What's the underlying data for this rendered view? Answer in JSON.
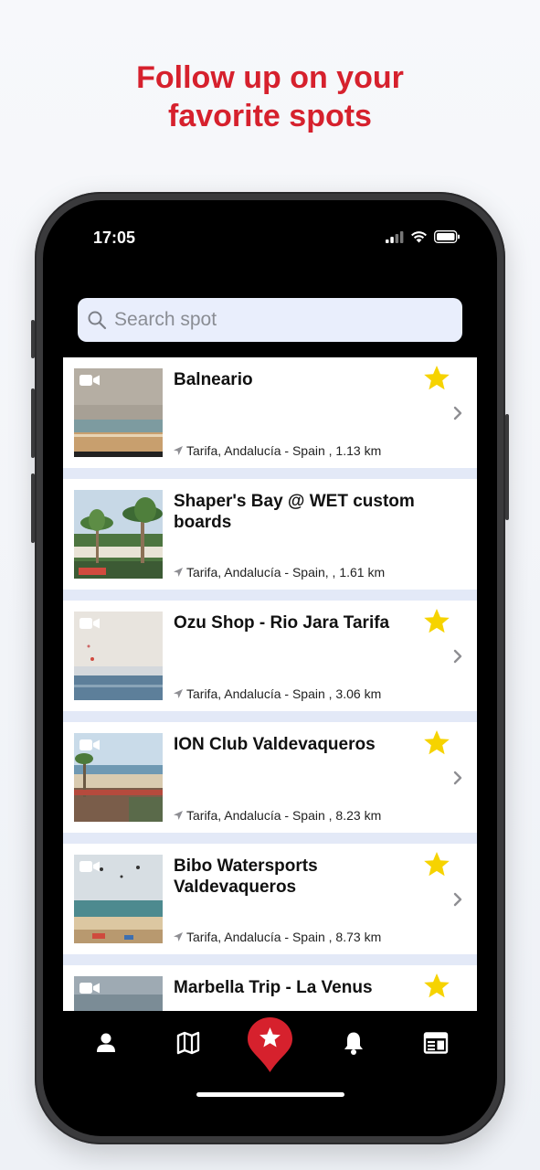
{
  "headline": {
    "line1": "Follow up on your",
    "line2": "favorite spots"
  },
  "status_bar": {
    "time": "17:05"
  },
  "search": {
    "placeholder": "Search spot"
  },
  "spots": [
    {
      "title": "Balneario",
      "location": "Tarifa, Andalucía - Spain , 1.13 km",
      "favorite": true,
      "has_camera": true
    },
    {
      "title": "Shaper's Bay @ WET custom boards",
      "location": "Tarifa, Andalucía - Spain, , 1.61 km",
      "favorite": false,
      "has_camera": false
    },
    {
      "title": "Ozu Shop - Rio Jara Tarifa",
      "location": "Tarifa, Andalucía - Spain , 3.06 km",
      "favorite": true,
      "has_camera": true
    },
    {
      "title": "ION Club Valdevaqueros",
      "location": "Tarifa, Andalucía - Spain , 8.23 km",
      "favorite": true,
      "has_camera": true
    },
    {
      "title": "Bibo Watersports Valdevaqueros",
      "location": "Tarifa, Andalucía - Spain , 8.73 km",
      "favorite": true,
      "has_camera": true
    },
    {
      "title": "Marbella Trip - La Venus",
      "location": "",
      "favorite": true,
      "has_camera": true
    }
  ],
  "tabbar": {
    "items": [
      "user-icon",
      "map-icon",
      "favorites-star-icon",
      "bell-icon",
      "news-icon"
    ],
    "active": "favorites-star-icon"
  },
  "colors": {
    "accent": "#d6212d",
    "star": "#f6d300",
    "list_bg": "#e3e9f7",
    "search_bg": "#e9eefc"
  }
}
